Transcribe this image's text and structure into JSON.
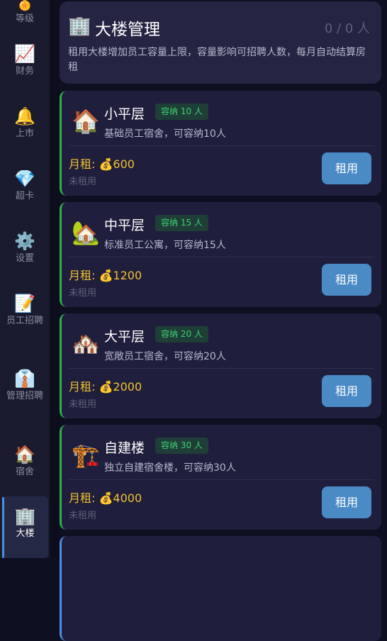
{
  "sidebar": {
    "items": [
      {
        "icon": "🏅",
        "label": "等级",
        "icon_name": "level-medal-icon"
      },
      {
        "icon": "📈",
        "label": "财务",
        "icon_name": "finance-chart-icon"
      },
      {
        "icon": "🔔",
        "label": "上市",
        "icon_name": "ipo-bell-icon"
      },
      {
        "icon": "💎",
        "label": "超卡",
        "icon_name": "super-card-diamond-icon"
      },
      {
        "icon": "⚙️",
        "label": "设置",
        "icon_name": "settings-gear-icon"
      },
      {
        "icon": "📝",
        "label": "员工招聘",
        "icon_name": "employee-recruit-memo-icon"
      },
      {
        "icon": "👔",
        "label": "管理招聘",
        "icon_name": "manager-recruit-tie-icon"
      },
      {
        "icon": "🏠",
        "label": "宿舍",
        "icon_name": "dorm-house-icon"
      },
      {
        "icon": "🏢",
        "label": "大楼",
        "icon_name": "building-icon"
      }
    ]
  },
  "header": {
    "icon": "🏢",
    "title": "大楼管理",
    "count": "0 / 0 人",
    "description": "租用大楼增加员工容量上限，容量影响可招聘人数，每月自动结算房租"
  },
  "floors": [
    {
      "icon": "🏠",
      "name": "小平层",
      "capacity": "容纳 10 人",
      "desc": "基础员工宿舍，可容纳10人",
      "rent_label": "月租:",
      "rent_icon": "💰",
      "rent": "600",
      "status": "未租用",
      "button": "租用"
    },
    {
      "icon": "🏡",
      "name": "中平层",
      "capacity": "容纳 15 人",
      "desc": "标准员工公寓，可容纳15人",
      "rent_label": "月租:",
      "rent_icon": "💰",
      "rent": "1200",
      "status": "未租用",
      "button": "租用"
    },
    {
      "icon": "🏘️",
      "name": "大平层",
      "capacity": "容纳 20 人",
      "desc": "宽敞员工宿舍，可容纳20人",
      "rent_label": "月租:",
      "rent_icon": "💰",
      "rent": "2000",
      "status": "未租用",
      "button": "租用"
    },
    {
      "icon": "🏗️",
      "name": "自建楼",
      "capacity": "容纳 30 人",
      "desc": "独立自建宿舍楼，可容纳30人",
      "rent_label": "月租:",
      "rent_icon": "💰",
      "rent": "4000",
      "status": "未租用",
      "button": "租用"
    }
  ],
  "colors": {
    "accent": "#4a8ac5",
    "rent": "#f1c232",
    "badge_text": "#3dd173",
    "card_bar": "#2fb04a"
  }
}
